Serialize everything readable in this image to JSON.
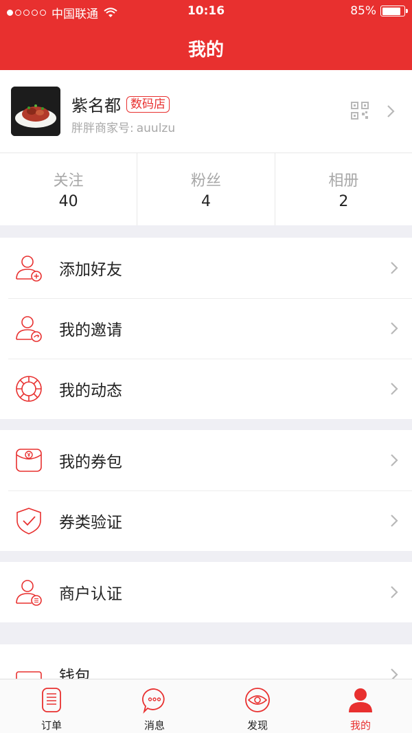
{
  "status_bar": {
    "carrier": "中国联通",
    "time": "10:16",
    "battery": "85%",
    "battery_level": 0.85,
    "signal_bars": 1
  },
  "nav": {
    "title": "我的"
  },
  "profile": {
    "name": "紫名都",
    "tag": "数码店",
    "merchant_label": "胖胖商家号:",
    "merchant_id": "auulzu"
  },
  "stats": [
    {
      "label": "关注",
      "value": "40"
    },
    {
      "label": "粉丝",
      "value": "4"
    },
    {
      "label": "相册",
      "value": "2"
    }
  ],
  "menu": {
    "add_friend": "添加好友",
    "invite": "我的邀请",
    "activity": "我的动态",
    "coupon_bag": "我的券包",
    "coupon_verify": "券类验证",
    "merchant_auth": "商户认证",
    "wallet": "钱包"
  },
  "tabbar": [
    {
      "label": "订单",
      "icon": "order-icon"
    },
    {
      "label": "消息",
      "icon": "message-icon"
    },
    {
      "label": "发现",
      "icon": "discover-icon"
    },
    {
      "label": "我的",
      "icon": "profile-icon"
    }
  ],
  "colors": {
    "accent": "#e8302f",
    "background": "#efeff4"
  }
}
